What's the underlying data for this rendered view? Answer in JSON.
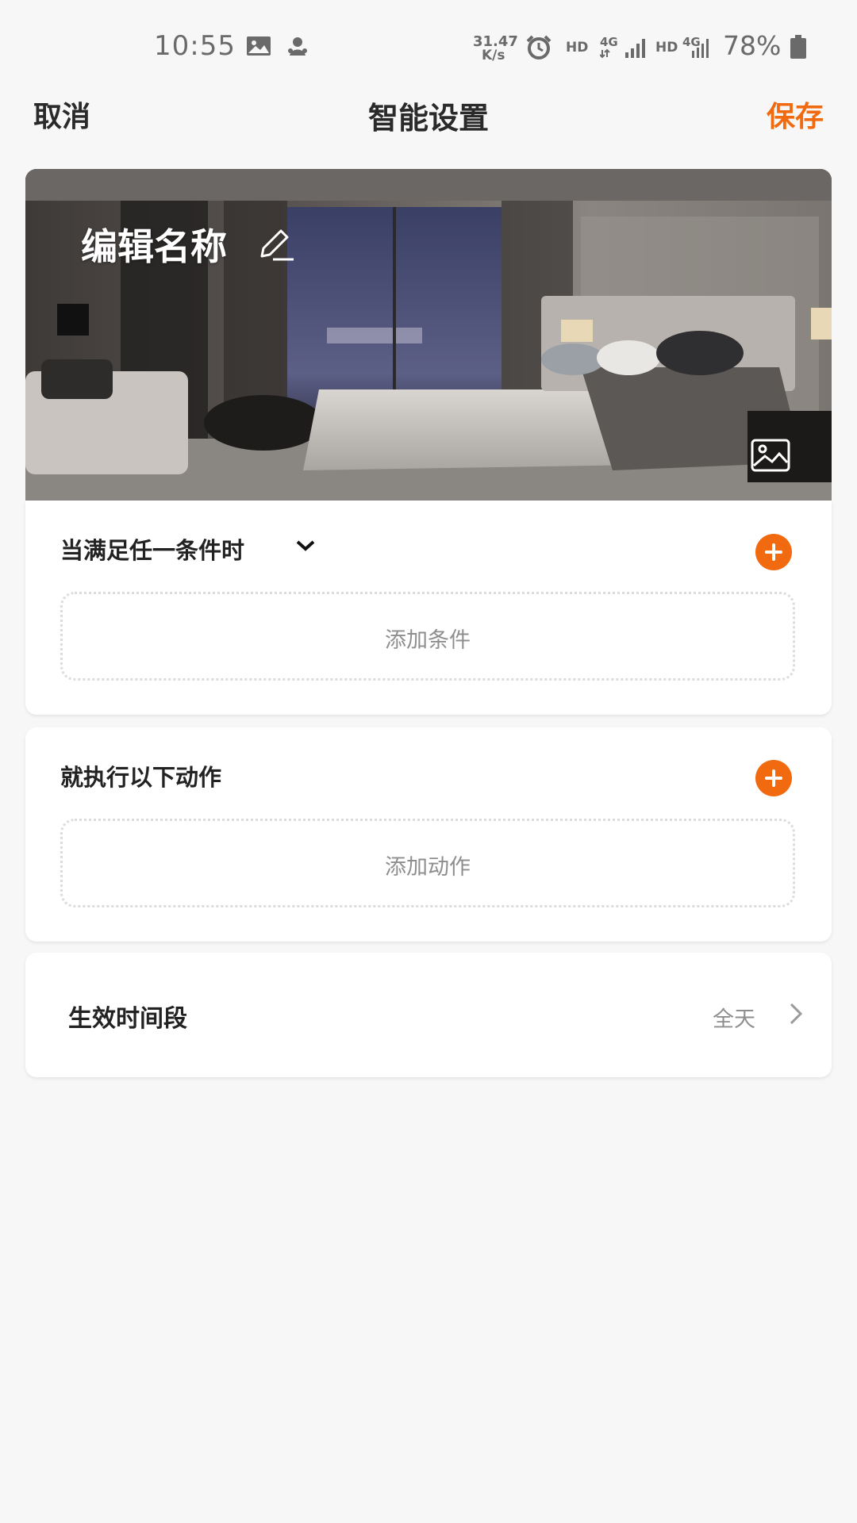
{
  "status_bar": {
    "time": "10:55",
    "net_speed_value": "31.47",
    "net_speed_unit": "K/s",
    "sim1_type": "HD",
    "sim1_network": "4G",
    "sim2_type": "HD",
    "sim2_network": "4G",
    "battery": "78%",
    "icons": [
      "gallery-icon",
      "notification-icon",
      "alarm-icon",
      "signal-icon",
      "battery-icon"
    ]
  },
  "header": {
    "cancel_label": "取消",
    "title": "智能设置",
    "save_label": "保存"
  },
  "banner": {
    "name": "编辑名称",
    "icons": [
      "edit-icon",
      "image-icon"
    ]
  },
  "condition_section": {
    "title": "当满足任一条件时",
    "add_label": "添加条件"
  },
  "action_section": {
    "title": "就执行以下动作",
    "add_label": "添加动作"
  },
  "time_section": {
    "label": "生效时间段",
    "value": "全天"
  },
  "colors": {
    "accent": "#f26a10",
    "background": "#f7f7f7",
    "card": "#ffffff",
    "muted_text": "#8e8e8e"
  }
}
